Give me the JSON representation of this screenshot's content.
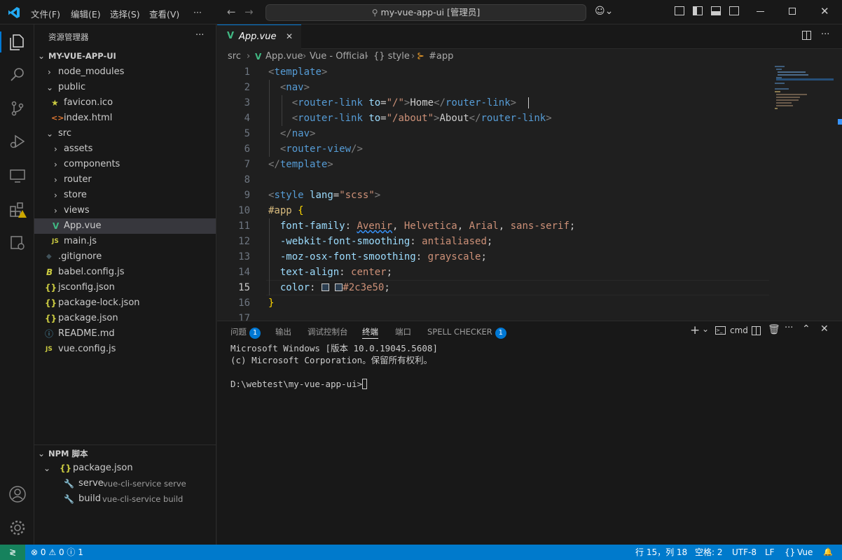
{
  "titlebar": {
    "menus": [
      "文件(F)",
      "编辑(E)",
      "选择(S)",
      "查看(V)"
    ],
    "more": "···",
    "command_center": "my-vue-app-ui [管理员]"
  },
  "sidebar": {
    "header": "资源管理器",
    "more": "···",
    "project": "MY-VUE-APP-UI",
    "tree": [
      {
        "label": "node_modules",
        "type": "folder-closed"
      },
      {
        "label": "public",
        "type": "folder-open"
      },
      {
        "label": "favicon.ico",
        "type": "file",
        "icon": "★"
      },
      {
        "label": "index.html",
        "type": "file",
        "icon": "<>"
      },
      {
        "label": "src",
        "type": "folder-open"
      },
      {
        "label": "assets",
        "type": "folder-closed"
      },
      {
        "label": "components",
        "type": "folder-closed"
      },
      {
        "label": "router",
        "type": "folder-closed"
      },
      {
        "label": "store",
        "type": "folder-closed"
      },
      {
        "label": "views",
        "type": "folder-closed"
      },
      {
        "label": "App.vue",
        "type": "file",
        "icon": "V"
      },
      {
        "label": "main.js",
        "type": "file",
        "icon": "JS"
      },
      {
        "label": ".gitignore",
        "type": "file",
        "icon": "◆"
      },
      {
        "label": "babel.config.js",
        "type": "file",
        "icon": "B"
      },
      {
        "label": "jsconfig.json",
        "type": "file",
        "icon": "{}"
      },
      {
        "label": "package-lock.json",
        "type": "file",
        "icon": "{}"
      },
      {
        "label": "package.json",
        "type": "file",
        "icon": "{}"
      },
      {
        "label": "README.md",
        "type": "file",
        "icon": "ⓘ"
      },
      {
        "label": "vue.config.js",
        "type": "file",
        "icon": "JS"
      }
    ],
    "npm": {
      "header": "NPM 脚本",
      "package": "package.json",
      "scripts": [
        {
          "name": "serve",
          "cmd": "vue-cli-service serve"
        },
        {
          "name": "build",
          "cmd": "vue-cli-service build"
        }
      ]
    }
  },
  "editor": {
    "tab": "App.vue",
    "close": "✕",
    "breadcrumbs": [
      "src",
      "App.vue",
      "Vue - Official",
      "{} style",
      "#app"
    ],
    "line_numbers": [
      "1",
      "2",
      "3",
      "4",
      "5",
      "6",
      "7",
      "8",
      "9",
      "10",
      "11",
      "12",
      "13",
      "14",
      "15",
      "16",
      "17"
    ],
    "current_line": "15"
  },
  "panel": {
    "tabs": [
      "问题",
      "输出",
      "调试控制台",
      "终端",
      "端口",
      "SPELL CHECKER"
    ],
    "active_tab": "终端",
    "problems_badge": "1",
    "spell_badge": "1",
    "shell": "cmd",
    "terminal_lines": [
      "Microsoft Windows [版本 10.0.19045.5608]",
      "(c) Microsoft Corporation。保留所有权利。",
      "",
      "D:\\webtest\\my-vue-app-ui>"
    ]
  },
  "status": {
    "errors": "0",
    "warnings": "0",
    "info": "1",
    "position": "行 15，列 18",
    "indent": "空格: 2",
    "encoding": "UTF-8",
    "eol": "LF",
    "language": "Vue",
    "bell": "🔔"
  },
  "colors": {
    "accent": "#007acc",
    "tag": "#569cd6",
    "attr": "#9cdcfe",
    "string": "#ce9178",
    "selector": "#d7ba7d",
    "vue_green": "#41b883",
    "js_yellow": "#cbcb41"
  }
}
